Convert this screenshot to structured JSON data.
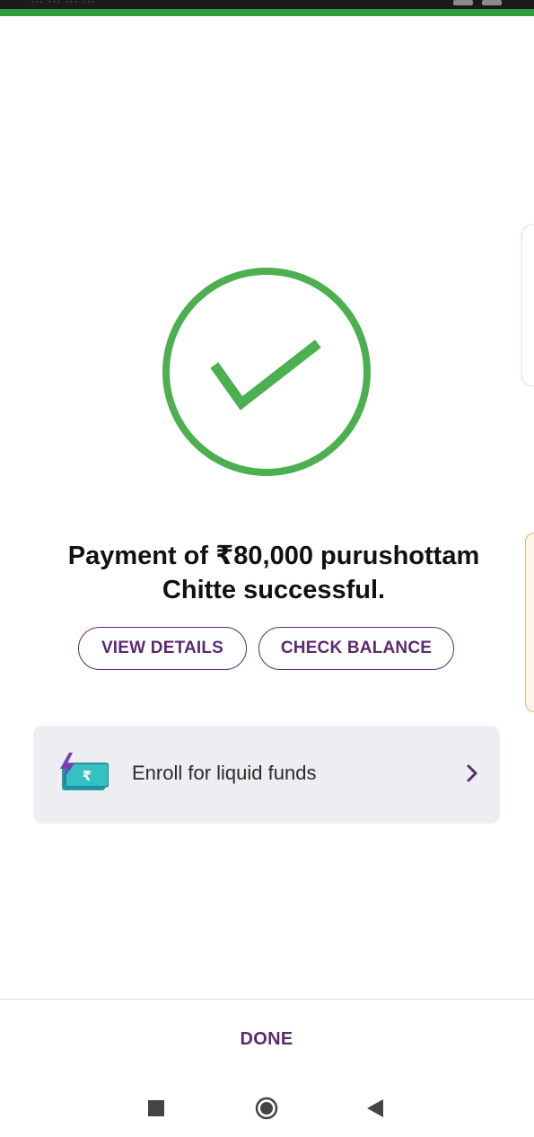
{
  "status_bar": {
    "text": "··· ··· ··· ···"
  },
  "message": {
    "line1": "Payment of ₹80,000 purushottam",
    "line2": "Chitte successful."
  },
  "buttons": {
    "view_details": "VIEW DETAILS",
    "check_balance": "CHECK BALANCE",
    "done": "DONE"
  },
  "card": {
    "label": "Enroll for liquid funds",
    "icon": "rupee-note-icon"
  },
  "colors": {
    "success_green": "#4caf50",
    "brand_purple": "#5b2a6e",
    "card_bg": "#eceef2"
  },
  "nav": {
    "recent_icon": "recent-apps-icon",
    "home_icon": "home-icon",
    "back_icon": "back-icon"
  }
}
